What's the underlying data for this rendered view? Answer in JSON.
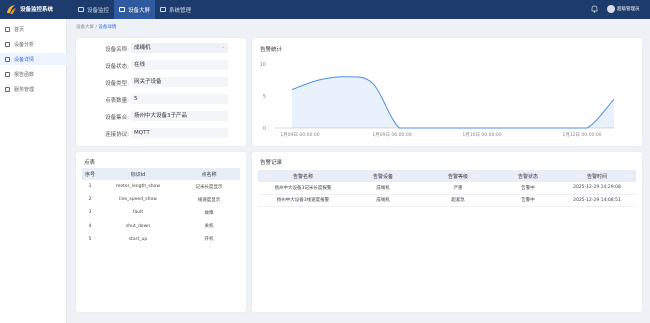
{
  "app": {
    "title": "设备监控系统"
  },
  "nav": [
    {
      "label": "设备监控"
    },
    {
      "label": "设备大屏"
    },
    {
      "label": "系统管理"
    }
  ],
  "user": {
    "name": "超级管理员"
  },
  "sidebar": [
    {
      "label": "首页"
    },
    {
      "label": "设备分析"
    },
    {
      "label": "设备详情"
    },
    {
      "label": "报告函数"
    },
    {
      "label": "服务管理"
    }
  ],
  "breadcrumb": {
    "parent": "设备大屏",
    "sep": "/",
    "current": "设备详情"
  },
  "device": {
    "name_label": "设备名称:",
    "name_value": "成绳机",
    "status_label": "设备状态:",
    "status_value": "在线",
    "type_label": "设备类型:",
    "type_value": "网关子设备",
    "points_label": "点表数量:",
    "points_value": "5",
    "group_label": "设备集合:",
    "group_value": "扬州中大设备3子产品",
    "protocol_label": "连接协议:",
    "protocol_value": "MQTT"
  },
  "alarm_stats": {
    "title": "告警统计"
  },
  "point_table": {
    "title": "点表",
    "headers": [
      "序号",
      "标识id",
      "点名称"
    ],
    "rows": [
      [
        "1",
        "meter_length_show",
        "记米长度显示"
      ],
      [
        "2",
        "line_speed_show",
        "线速度显示"
      ],
      [
        "3",
        "fault",
        "故障"
      ],
      [
        "4",
        "shut_down",
        "关机"
      ],
      [
        "5",
        "start_up",
        "开机"
      ]
    ]
  },
  "alarm_log": {
    "title": "告警记录",
    "headers": [
      "告警名称",
      "告警设备",
      "告警等级",
      "告警状态",
      "告警时间"
    ],
    "rows": [
      [
        "扬州中大设备3记米长度报警",
        "成绳机",
        "严重",
        "告警中",
        "2025-12-29 14:29:08"
      ],
      [
        "扬州中大设备3线速度报警",
        "成绳机",
        "超紧急",
        "告警中",
        "2025-12-29 14:08:51"
      ]
    ]
  },
  "chart_data": {
    "type": "area",
    "title": "告警统计",
    "x": [
      "1月09日 00:00:00",
      "1月09日 06:00:00",
      "1月10日 00:00:00",
      "1月12日 00:00:00"
    ],
    "ylim": [
      0,
      10
    ],
    "yticks": [
      "10",
      "5",
      "0"
    ],
    "series": [
      {
        "values": [
          6,
          7.5,
          8,
          7,
          0,
          0,
          0,
          0,
          0,
          0,
          0,
          0,
          4.5
        ]
      }
    ],
    "grid": false,
    "color": "#4c8de8"
  }
}
